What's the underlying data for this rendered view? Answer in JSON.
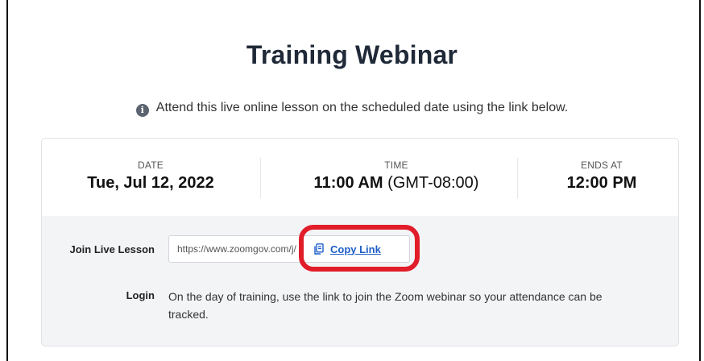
{
  "page": {
    "title": "Training Webinar",
    "notice": "Attend this live online lesson on the scheduled date using the link below.",
    "notice_icon": "info-icon"
  },
  "schedule": {
    "date_label": "DATE",
    "date_value": "Tue, Jul 12, 2022",
    "time_label": "TIME",
    "time_value": "11:00 AM",
    "time_zone": "(GMT-08:00)",
    "ends_label": "ENDS AT",
    "ends_value": "12:00 PM"
  },
  "join": {
    "label": "Join Live Lesson",
    "url_text": "https://www.zoomgov.com/j/",
    "copy_label": "Copy Link",
    "copy_icon": "copy-icon"
  },
  "login": {
    "label": "Login",
    "text": "On the day of training, use the link to join the Zoom webinar so your attendance can be tracked."
  },
  "colors": {
    "link": "#1d5ec8",
    "highlight": "#e11d2a",
    "panel": "#f3f4f6"
  }
}
